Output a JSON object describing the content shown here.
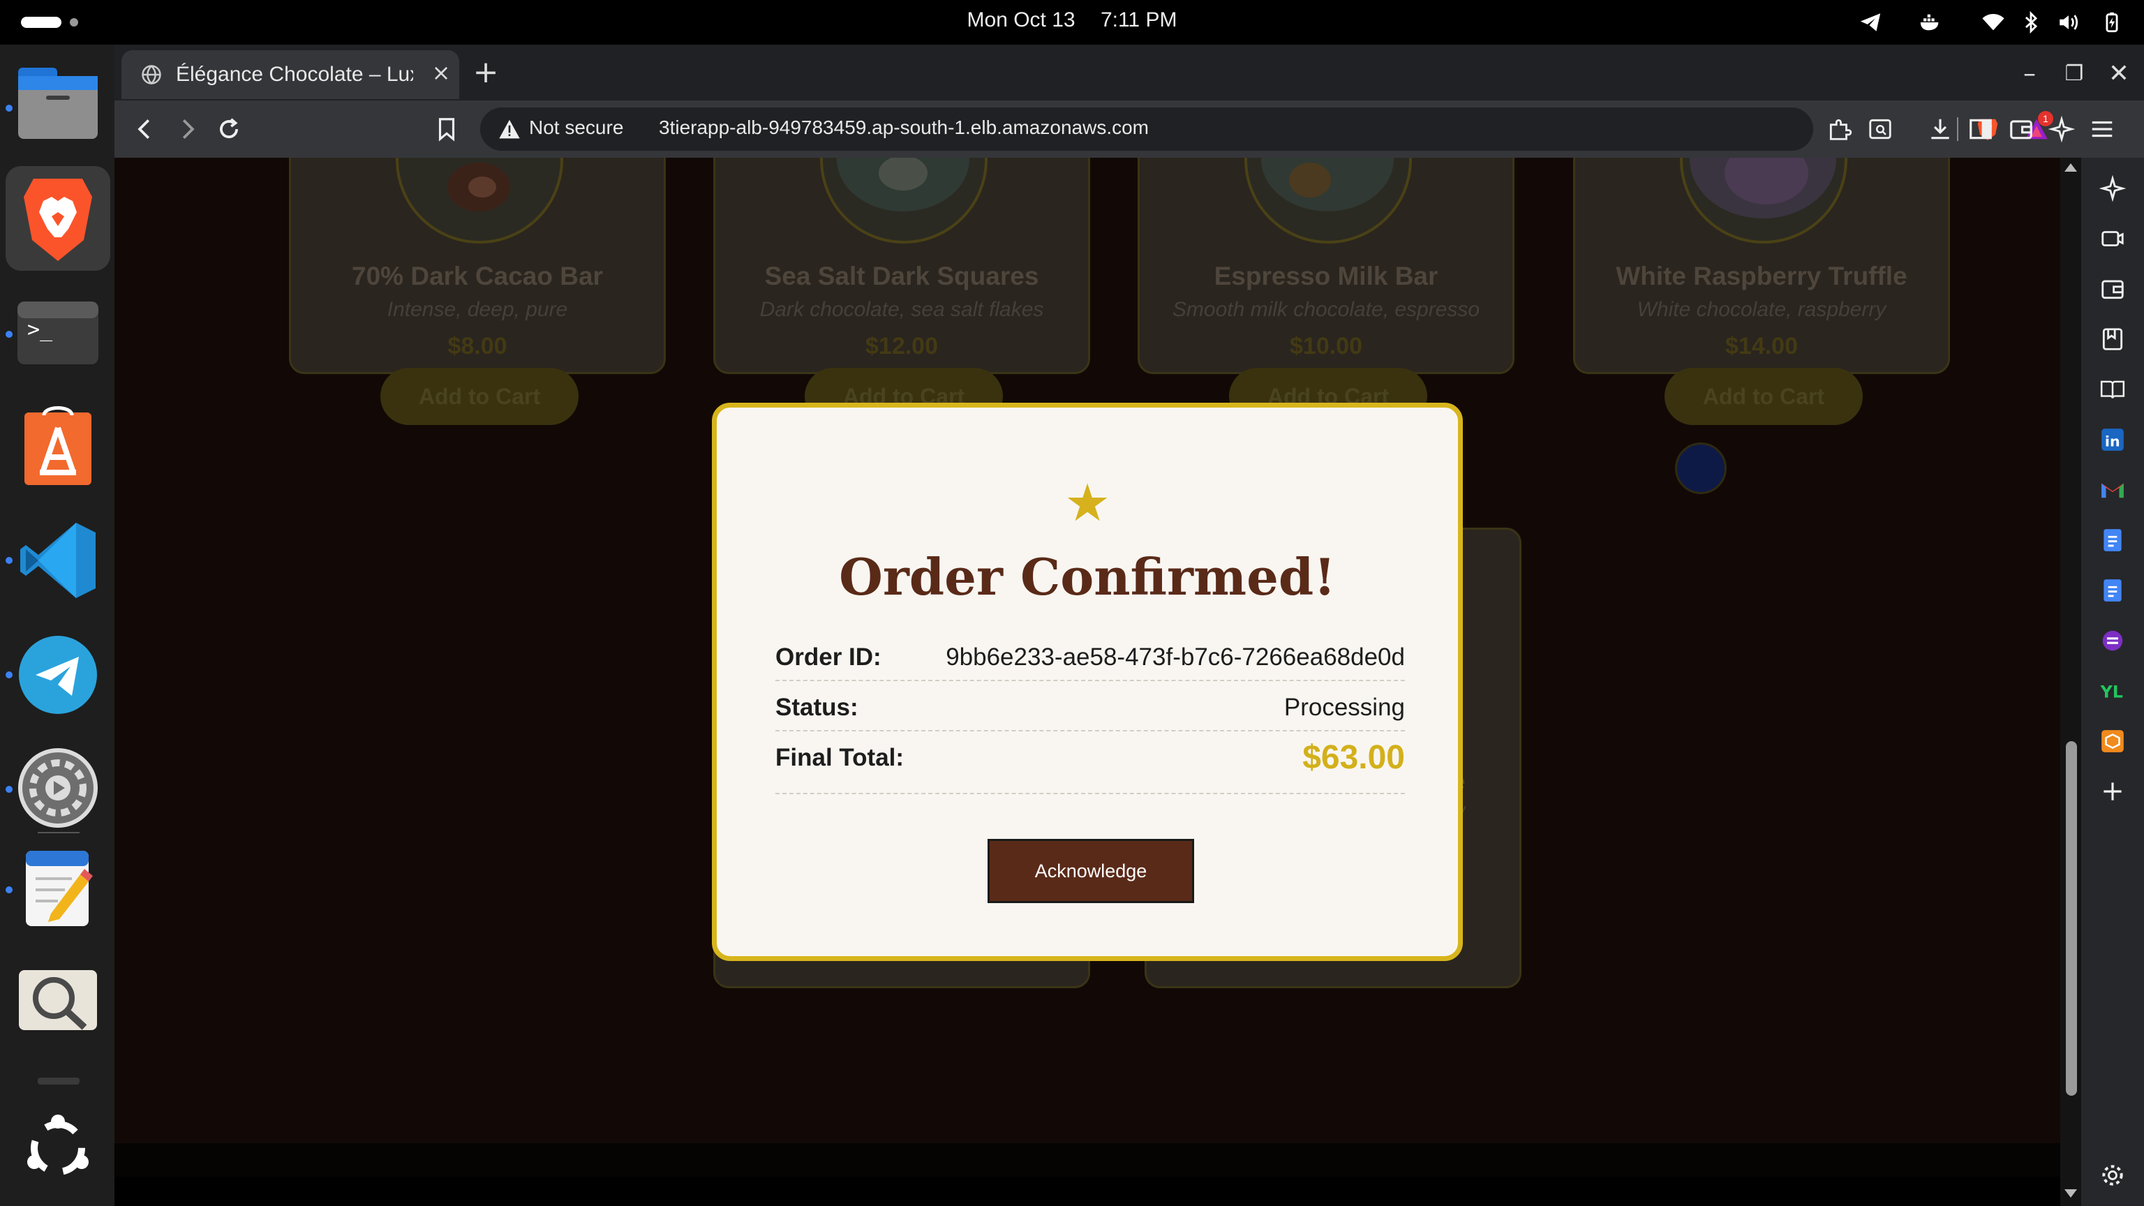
{
  "system": {
    "date": "Mon Oct 13",
    "time": "7:11 PM"
  },
  "browser": {
    "tab_title": "Élégance Chocolate – Luxury",
    "new_tab_label": "+",
    "security_label": "Not secure",
    "url": "3tierapp-alb-949783459.ap-south-1.elb.amazonaws.com",
    "alert_badge": "1"
  },
  "products": [
    {
      "name": "70% Dark Cacao Bar",
      "description": "Intense, deep, pure",
      "price": "$8.00",
      "button": "Add to Cart"
    },
    {
      "name": "Sea Salt Dark Squares",
      "description": "Dark chocolate, sea salt flakes",
      "price": "$12.00",
      "button": "Add to Cart"
    },
    {
      "name": "Espresso Milk Bar",
      "description": "Smooth milk chocolate, espresso",
      "price": "$10.00",
      "button": "Add to Cart"
    },
    {
      "name": "White Raspberry Truffle",
      "description": "White chocolate, raspberry",
      "price": "$14.00",
      "button": "Add to Cart"
    }
  ],
  "row2_fragments": {
    "text_a": "e",
    "text_b": "e/"
  },
  "modal": {
    "icon": "★",
    "title": "Order Confirmed!",
    "rows": [
      {
        "label": "Order ID:",
        "value": "9bb6e233-ae58-473f-b7c6-7266ea68de0d"
      },
      {
        "label": "Status:",
        "value": "Processing"
      },
      {
        "label": "Final Total:",
        "value": "$63.00"
      }
    ],
    "button": "Acknowledge",
    "accent_color": "#d7b51c",
    "brand_color": "#5a2a18"
  }
}
